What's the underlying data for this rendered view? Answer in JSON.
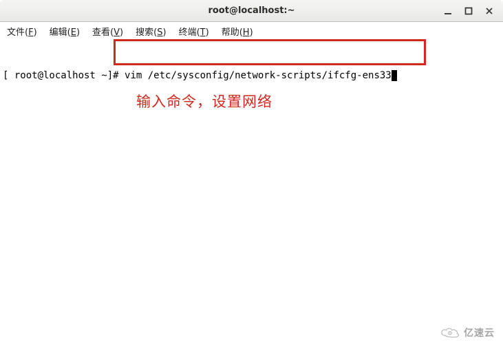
{
  "window": {
    "title": "root@localhost:~"
  },
  "menubar": {
    "file": {
      "label": "文件",
      "key": "F"
    },
    "edit": {
      "label": "编辑",
      "key": "E"
    },
    "view": {
      "label": "查看",
      "key": "V"
    },
    "search": {
      "label": "搜索",
      "key": "S"
    },
    "term": {
      "label": "终端",
      "key": "T"
    },
    "help": {
      "label": "帮助",
      "key": "H"
    }
  },
  "terminal": {
    "prompt": "[ root@localhost ~]# ",
    "command": "vim /etc/sysconfig/network-scripts/ifcfg-ens33"
  },
  "annotation": {
    "text": "输入命令，设置网络"
  },
  "watermark": {
    "text": "亿速云"
  },
  "colors": {
    "highlight_border": "#d4281f",
    "annotation_text": "#d4281f"
  }
}
